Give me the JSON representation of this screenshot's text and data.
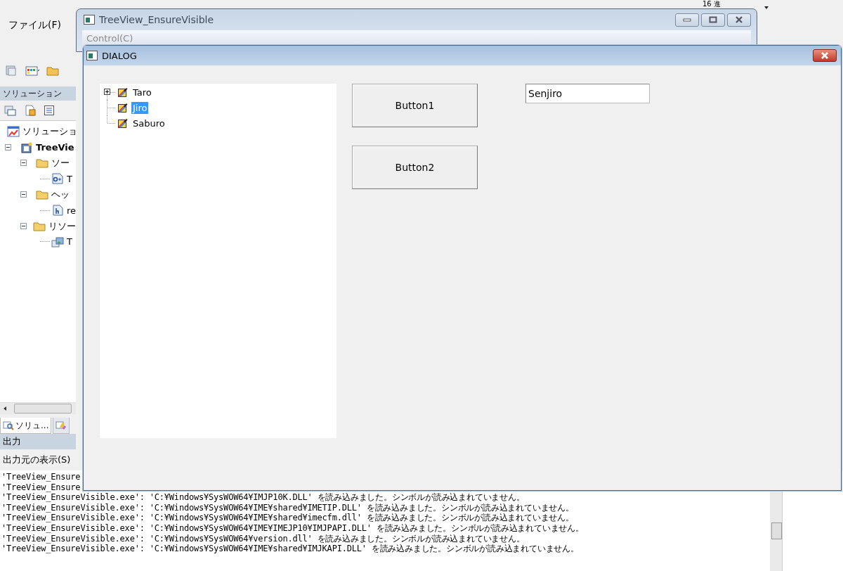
{
  "ide": {
    "menu": [
      "ファイル(F)"
    ],
    "toolbar_text": "16 進",
    "solution_explorer": {
      "title": "ソリューション",
      "tree": [
        {
          "label": "ソリューショ",
          "kind": "solution",
          "children": [
            {
              "label": "TreeVie",
              "kind": "project",
              "expanded": true,
              "children": [
                {
                  "label": "ソー",
                  "kind": "folder",
                  "expanded": true,
                  "children": [
                    {
                      "label": "T",
                      "kind": "cpp"
                    }
                  ]
                },
                {
                  "label": "ヘッ",
                  "kind": "folder",
                  "expanded": true,
                  "children": [
                    {
                      "label": "re",
                      "kind": "header"
                    }
                  ]
                },
                {
                  "label": "リソー",
                  "kind": "folder",
                  "expanded": true,
                  "children": [
                    {
                      "label": "T",
                      "kind": "resource"
                    }
                  ]
                }
              ]
            }
          ]
        }
      ]
    },
    "panel_tabs": [
      {
        "label": "ソリュ...",
        "selected": true
      },
      {
        "selected": false
      }
    ],
    "output": {
      "title": "出力",
      "source_label": "出力元の表示(S)",
      "lines": [
        "'TreeView_Ensure",
        "'TreeView_Ensure",
        "'TreeView_EnsureVisible.exe': 'C:¥Windows¥SysWOW64¥IMJP10K.DLL' を読み込みました。シンボルが読み込まれていません。",
        "'TreeView_EnsureVisible.exe': 'C:¥Windows¥SysWOW64¥IME¥shared¥IMETIP.DLL' を読み込みました。シンボルが読み込まれていません。",
        "'TreeView_EnsureVisible.exe': 'C:¥Windows¥SysWOW64¥IME¥shared¥imecfm.dll' を読み込みました。シンボルが読み込まれていません。",
        "'TreeView_EnsureVisible.exe': 'C:¥Windows¥SysWOW64¥IME¥IMEJP10¥IMJPAPI.DLL' を読み込みました。シンボルが読み込まれていません。",
        "'TreeView_EnsureVisible.exe': 'C:¥Windows¥SysWOW64¥version.dll' を読み込みました。シンボルが読み込まれていません。",
        "'TreeView_EnsureVisible.exe': 'C:¥Windows¥SysWOW64¥IME¥shared¥IMJKAPI.DLL' を読み込みました。シンボルが読み込まれていません。"
      ]
    }
  },
  "main_window": {
    "title": "TreeView_EnsureVisible",
    "menu": [
      "Control(C)"
    ]
  },
  "dialog": {
    "title": "DIALOG",
    "tree": [
      {
        "label": "Taro",
        "selected": false,
        "expanded": false
      },
      {
        "label": "Jiro",
        "selected": true
      },
      {
        "label": "Saburo",
        "selected": false
      }
    ],
    "buttons": [
      "Button1",
      "Button2"
    ],
    "edit": {
      "value": "Senjiro"
    }
  }
}
